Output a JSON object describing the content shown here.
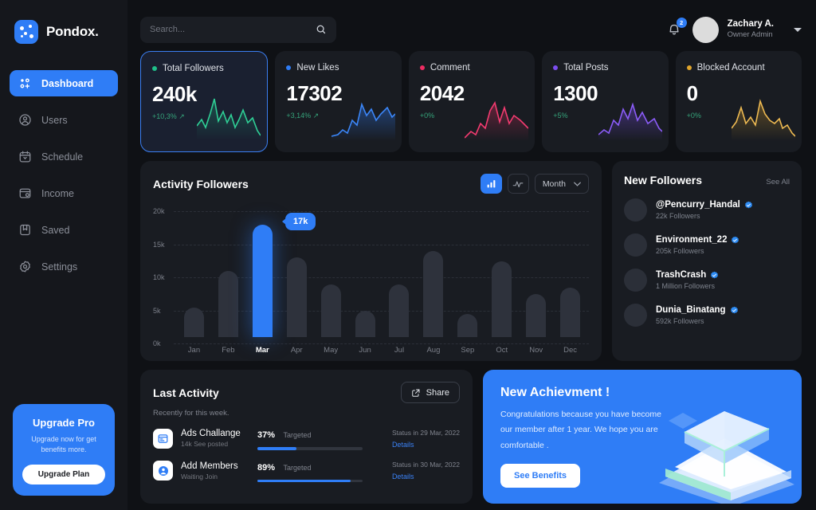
{
  "brand": {
    "name": "Pondox.",
    "logo_icon": "pondox-dots-logo"
  },
  "sidebar": {
    "items": [
      {
        "label": "Dashboard",
        "icon": "dashboard-grid-icon",
        "active": true
      },
      {
        "label": "Users",
        "icon": "user-circle-icon",
        "active": false
      },
      {
        "label": "Schedule",
        "icon": "calendar-icon",
        "active": false
      },
      {
        "label": "Income",
        "icon": "wallet-icon",
        "active": false
      },
      {
        "label": "Saved",
        "icon": "bookmark-icon",
        "active": false
      },
      {
        "label": "Settings",
        "icon": "gear-icon",
        "active": false
      }
    ],
    "upgrade": {
      "title": "Upgrade Pro",
      "subtitle": "Upgrade now for get benefits more.",
      "button": "Upgrade Plan"
    }
  },
  "header": {
    "search": {
      "placeholder": "Search...",
      "value": "",
      "icon": "search-icon"
    },
    "notification": {
      "icon": "bell-icon",
      "count": "2"
    },
    "user": {
      "name": "Zachary A.",
      "role": "Owner Admin",
      "avatar": "avatar"
    }
  },
  "stats": [
    {
      "label": "Total Followers",
      "value": "240k",
      "delta": "+10,3% ↗",
      "color": "#1fc08a",
      "active": true
    },
    {
      "label": "New Likes",
      "value": "17302",
      "delta": "+3,14% ↗",
      "color": "#2f7df6",
      "active": false
    },
    {
      "label": "Comment",
      "value": "2042",
      "delta": "+0%",
      "color": "#ee2d63",
      "active": false
    },
    {
      "label": "Total Posts",
      "value": "1300",
      "delta": "+5%",
      "color": "#7b4df0",
      "active": false
    },
    {
      "label": "Blocked Account",
      "value": "0",
      "delta": "+0%",
      "color": "#e0a52c",
      "active": false
    }
  ],
  "activity_chart": {
    "title": "Activity Followers",
    "toggles": [
      {
        "icon": "bar-chart-icon",
        "active": true
      },
      {
        "icon": "line-chart-icon",
        "active": false
      }
    ],
    "period": {
      "label": "Month",
      "icon": "chevron-down-icon"
    },
    "tooltip": "17k"
  },
  "chart_data": {
    "type": "bar",
    "title": "Activity Followers",
    "xlabel": "",
    "ylabel": "",
    "categories": [
      "Jan",
      "Feb",
      "Mar",
      "Apr",
      "May",
      "Jun",
      "Jul",
      "Aug",
      "Sep",
      "Oct",
      "Nov",
      "Dec"
    ],
    "values": [
      4.5,
      10.0,
      17.0,
      12.0,
      8.0,
      4.0,
      8.0,
      13.0,
      3.5,
      11.5,
      6.5,
      7.5
    ],
    "unit": "k",
    "ylim": [
      0,
      20
    ],
    "yticks": [
      "0k",
      "5k",
      "10k",
      "15k",
      "20k"
    ],
    "ytick_values": [
      0,
      5,
      10,
      15,
      20
    ],
    "highlight_index": 2,
    "highlight_label": "17k",
    "grid": true,
    "legend": "none",
    "bar_color": "#2e323c",
    "highlight_color": "#2f7df6"
  },
  "new_followers": {
    "title": "New Followers",
    "see_all": "See All",
    "items": [
      {
        "name": "@Pencurry_Handal",
        "followers": "22k Followers",
        "verified": true
      },
      {
        "name": "Environment_22",
        "followers": "205k Followers",
        "verified": true
      },
      {
        "name": "TrashCrash",
        "followers": "1 Million Followers",
        "verified": true
      },
      {
        "name": "Dunia_Binatang",
        "followers": "592k Followers",
        "verified": true
      }
    ]
  },
  "last_activity": {
    "title": "Last Activity",
    "subtitle": "Recently for this week.",
    "share": {
      "label": "Share",
      "icon": "share-external-icon"
    },
    "targeted_label": "Targeted",
    "details_label": "Details",
    "items": [
      {
        "name": "Ads Challange",
        "note": "14k See posted",
        "percent": "37%",
        "percent_value": 37,
        "status": "Status in 29 Mar, 2022",
        "icon": "ads-window-icon"
      },
      {
        "name": "Add Members",
        "note": "Waiting Join",
        "percent": "89%",
        "percent_value": 89,
        "status": "Status in 30 Mar, 2022",
        "icon": "person-add-icon"
      }
    ]
  },
  "achievement": {
    "title": "New Achievment !",
    "body": "Congratulations because you have become our member after 1 year. We hope you are comfortable .",
    "button": "See Benefits",
    "illustration": "isometric-cube-podium"
  }
}
